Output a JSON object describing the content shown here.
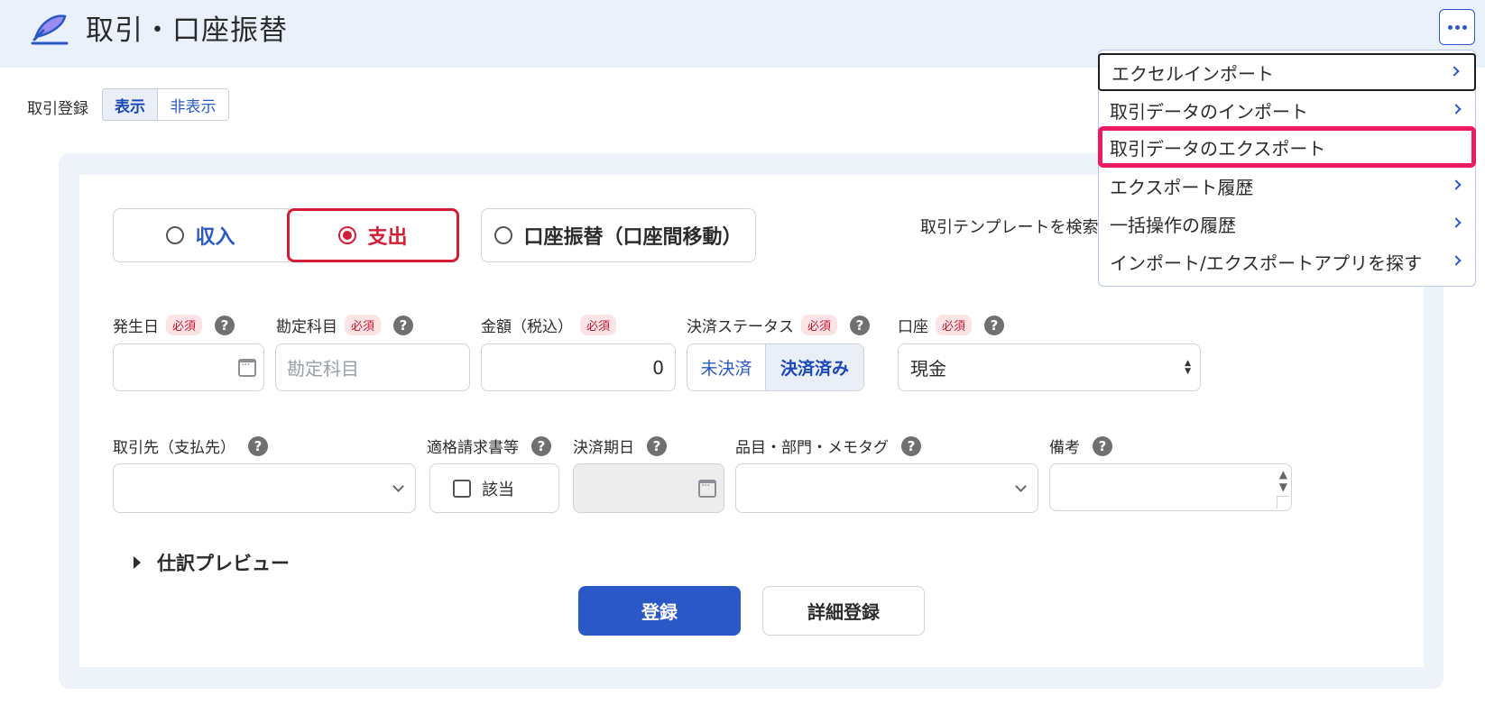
{
  "header": {
    "title": "取引・口座振替",
    "logo_icon": "pen-feather-icon"
  },
  "registration_toggle": {
    "label": "取引登録",
    "show_label": "表示",
    "hide_label": "非表示",
    "selected": "表示"
  },
  "transaction_types": {
    "income": "収入",
    "expense": "支出",
    "transfer": "口座振替（口座間移動）",
    "selected": "支出"
  },
  "template_search": {
    "label": "取引テンプレートを検索"
  },
  "required_badge": "必須",
  "help_glyph": "?",
  "fields": {
    "date": {
      "label": "発生日",
      "value": ""
    },
    "account_item": {
      "label": "勘定科目",
      "placeholder": "勘定科目"
    },
    "amount": {
      "label": "金額（税込）",
      "value": "0"
    },
    "settlement_status": {
      "label": "決済ステータス",
      "unsettled": "未決済",
      "settled": "決済済み",
      "selected": "決済済み"
    },
    "wallet": {
      "label": "口座",
      "value": "現金"
    },
    "partner": {
      "label": "取引先（支払先）",
      "value": ""
    },
    "qualified_invoice": {
      "label": "適格請求書等",
      "checkbox_label": "該当",
      "checked": false
    },
    "due_date": {
      "label": "決済期日",
      "value": ""
    },
    "tags": {
      "label": "品目・部門・メモタグ",
      "value": ""
    },
    "note": {
      "label": "備考",
      "value": ""
    }
  },
  "journal_preview": {
    "label": "仕訳プレビュー"
  },
  "buttons": {
    "register": "登録",
    "detailed_register": "詳細登録"
  },
  "more_menu": {
    "items": [
      {
        "label": "エクセルインポート",
        "has_submenu": true
      },
      {
        "label": "取引データのインポート",
        "has_submenu": true
      },
      {
        "label": "取引データのエクスポート",
        "has_submenu": false
      },
      {
        "label": "エクスポート履歴",
        "has_submenu": true
      },
      {
        "label": "一括操作の履歴",
        "has_submenu": true
      },
      {
        "label": "インポート/エクスポートアプリを探す",
        "has_submenu": true
      }
    ]
  },
  "colors": {
    "primary": "#2a58c6",
    "expense_red": "#d41c35",
    "highlight_pink": "#ec1a63",
    "header_bg": "#eaf1fb"
  }
}
